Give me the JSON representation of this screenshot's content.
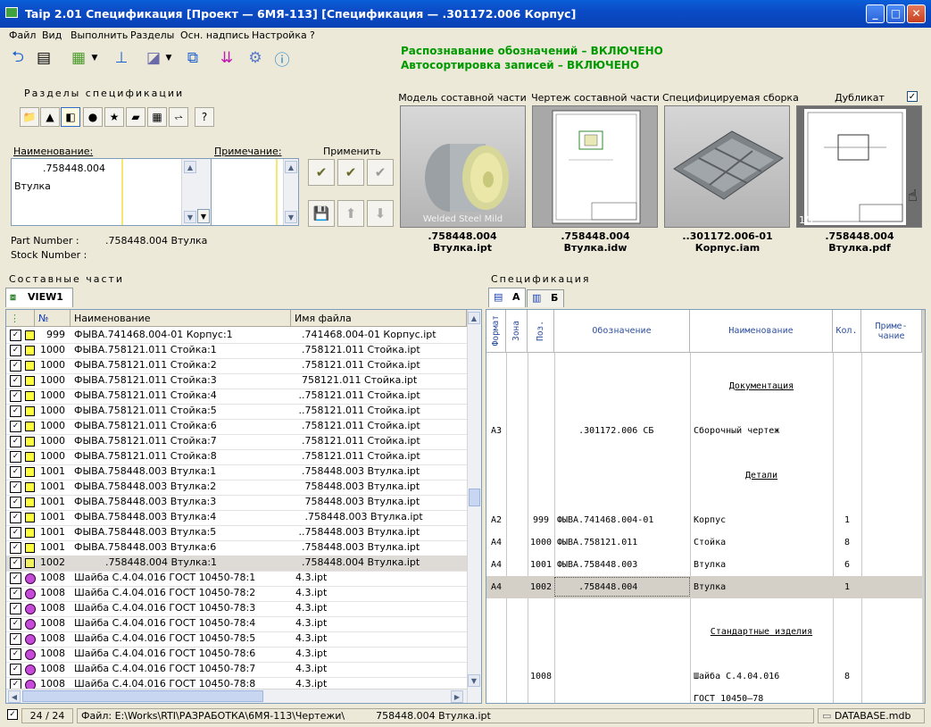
{
  "window": {
    "title": "Taip 2.01 Спецификация   [Проект — 6МЯ-113] [Спецификация —          .301172.006 Корпус]",
    "minimize": "_",
    "maximize": "□",
    "close": "✕"
  },
  "menu": [
    "Файл",
    "Вид",
    "Выполнить",
    "Разделы",
    "Осн. надпись",
    "Настройка",
    "?"
  ],
  "status_messages": {
    "recognition": "Распознавание обозначений – ВКЛЮЧЕНО",
    "autosort": "Автосортировка записей – ВКЛЮЧЕНО"
  },
  "sections_panel": {
    "caption": "Разделы спецификации",
    "help": "?"
  },
  "name_field": {
    "label": "Наименование:",
    "value_line1": "          .758448.004",
    "value_line2": "Втулка"
  },
  "note_field": {
    "label": "Примечание:"
  },
  "apply": {
    "label": "Применить"
  },
  "part_info": {
    "part_number_label": "Part Number :",
    "part_number_value": ".758448.004 Втулка",
    "stock_number_label": "Stock Number :"
  },
  "thumbnails": [
    {
      "title": "Модель составной части",
      "code": ".758448.004",
      "file": "Втулка.ipt",
      "overlay": "Welded Steel Mild"
    },
    {
      "title": "Чертеж составной части",
      "code": ".758448.004",
      "file": "Втулка.idw"
    },
    {
      "title": "Специфицируемая сборка",
      "code": "..301172.006-01",
      "file": "Корпус.iam"
    },
    {
      "title": "Дубликат",
      "code": ".758448.004",
      "file": "Втулка.pdf",
      "page": "1/1"
    }
  ],
  "duplicate_checked": "✓",
  "parts_panel": {
    "caption": "Составные части",
    "tab": "VIEW1",
    "columns": {
      "name": "Наименование",
      "file": "Имя файла"
    },
    "rows": [
      {
        "num": "999",
        "name": "ФЫВА.741468.004-01 Корпус:1",
        "file": "  .741468.004-01 Корпус.ipt",
        "mark": "square"
      },
      {
        "num": "1000",
        "name": "ФЫВА.758121.011 Стойка:1",
        "file": "  .758121.011 Стойка.ipt",
        "mark": "square"
      },
      {
        "num": "1000",
        "name": "ФЫВА.758121.011 Стойка:2",
        "file": "  .758121.011 Стойка.ipt",
        "mark": "square"
      },
      {
        "num": "1000",
        "name": "ФЫВА.758121.011 Стойка:3",
        "file": "  758121.011 Стойка.ipt",
        "mark": "square"
      },
      {
        "num": "1000",
        "name": "ФЫВА.758121.011 Стойка:4",
        "file": " ..758121.011 Стойка.ipt",
        "mark": "square"
      },
      {
        "num": "1000",
        "name": "ФЫВА.758121.011 Стойка:5",
        "file": " ..758121.011 Стойка.ipt",
        "mark": "square"
      },
      {
        "num": "1000",
        "name": "ФЫВА.758121.011 Стойка:6",
        "file": "  .758121.011 Стойка.ipt",
        "mark": "square"
      },
      {
        "num": "1000",
        "name": "ФЫВА.758121.011 Стойка:7",
        "file": "  .758121.011 Стойка.ipt",
        "mark": "square"
      },
      {
        "num": "1000",
        "name": "ФЫВА.758121.011 Стойка:8",
        "file": "  .758121.011 Стойка.ipt",
        "mark": "square"
      },
      {
        "num": "1001",
        "name": "ФЫВА.758448.003 Втулка:1",
        "file": "  .758448.003 Втулка.ipt",
        "mark": "square"
      },
      {
        "num": "1001",
        "name": "ФЫВА.758448.003 Втулка:2",
        "file": "   758448.003 Втулка.ipt",
        "mark": "square"
      },
      {
        "num": "1001",
        "name": "ФЫВА.758448.003 Втулка:3",
        "file": "   758448.003 Втулка.ipt",
        "mark": "square"
      },
      {
        "num": "1001",
        "name": "ФЫВА.758448.003 Втулка:4",
        "file": "   .758448.003 Втулка.ipt",
        "mark": "square"
      },
      {
        "num": "1001",
        "name": "ФЫВА.758448.003 Втулка:5",
        "file": " ..758448.003 Втулка.ipt",
        "mark": "square"
      },
      {
        "num": "1001",
        "name": "ФЫВА.758448.003 Втулка:6",
        "file": "  .758448.003 Втулка.ipt",
        "mark": "square"
      },
      {
        "num": "1002",
        "name": "          .758448.004 Втулка:1",
        "file": "  .758448.004 Втулка.ipt",
        "mark": "square",
        "selected": true
      },
      {
        "num": "1008",
        "name": "Шайба С.4.04.016 ГОСТ 10450-78:1",
        "file": "4.3.ipt",
        "mark": "dot"
      },
      {
        "num": "1008",
        "name": "Шайба С.4.04.016 ГОСТ 10450-78:2",
        "file": "4.3.ipt",
        "mark": "dot"
      },
      {
        "num": "1008",
        "name": "Шайба С.4.04.016 ГОСТ 10450-78:3",
        "file": "4.3.ipt",
        "mark": "dot"
      },
      {
        "num": "1008",
        "name": "Шайба С.4.04.016 ГОСТ 10450-78:4",
        "file": "4.3.ipt",
        "mark": "dot"
      },
      {
        "num": "1008",
        "name": "Шайба С.4.04.016 ГОСТ 10450-78:5",
        "file": "4.3.ipt",
        "mark": "dot"
      },
      {
        "num": "1008",
        "name": "Шайба С.4.04.016 ГОСТ 10450-78:6",
        "file": "4.3.ipt",
        "mark": "dot"
      },
      {
        "num": "1008",
        "name": "Шайба С.4.04.016 ГОСТ 10450-78:7",
        "file": "4.3.ipt",
        "mark": "dot"
      },
      {
        "num": "1008",
        "name": "Шайба С.4.04.016 ГОСТ 10450-78:8",
        "file": "4.3.ipt",
        "mark": "dot"
      }
    ]
  },
  "spec_panel": {
    "caption": "Спецификация",
    "tabs": [
      "А",
      "Б"
    ],
    "columns": {
      "format": "Формат",
      "zone": "Зона",
      "pos": "Поз.",
      "designation": "Обозначение",
      "name": "Наименование",
      "qty": "Кол.",
      "note_line1": "Приме-",
      "note_line2": "чание"
    },
    "rows": [
      {
        "type": "blank"
      },
      {
        "type": "section",
        "name": "Документация"
      },
      {
        "type": "blank"
      },
      {
        "type": "item",
        "format": "А3",
        "pos": "",
        "designation": "    .301172.006 СБ",
        "name": "Сборочный чертеж",
        "qty": ""
      },
      {
        "type": "blank"
      },
      {
        "type": "section",
        "name": "Детали"
      },
      {
        "type": "blank"
      },
      {
        "type": "item",
        "format": "А2",
        "pos": "999",
        "designation": "ФЫВА.741468.004-01",
        "name": "Корпус",
        "qty": "1"
      },
      {
        "type": "item",
        "format": "А4",
        "pos": "1000",
        "designation": "ФЫВА.758121.011",
        "name": "Стойка",
        "qty": "8"
      },
      {
        "type": "item",
        "format": "А4",
        "pos": "1001",
        "designation": "ФЫВА.758448.003",
        "name": "Втулка",
        "qty": "6"
      },
      {
        "type": "item",
        "format": "А4",
        "pos": "1002",
        "designation": "    .758448.004",
        "name": "Втулка",
        "qty": "1",
        "selected": true
      },
      {
        "type": "blank"
      },
      {
        "type": "section",
        "name": "Стандартные изделия"
      },
      {
        "type": "blank"
      },
      {
        "type": "item",
        "format": "",
        "pos": "1008",
        "designation": "",
        "name": "Шайба С.4.04.016",
        "qty": "8"
      },
      {
        "type": "item",
        "format": "",
        "pos": "",
        "designation": "",
        "name": "ГОСТ 10450–78",
        "qty": ""
      }
    ]
  },
  "statusbar": {
    "count": "24 / 24",
    "file": "Файл: E:\\Works\\RTI\\РАЗРАБОТКА\\6МЯ-113\\Чертежи\\          758448.004 Втулка.ipt",
    "database": "DATABASE.mdb"
  }
}
